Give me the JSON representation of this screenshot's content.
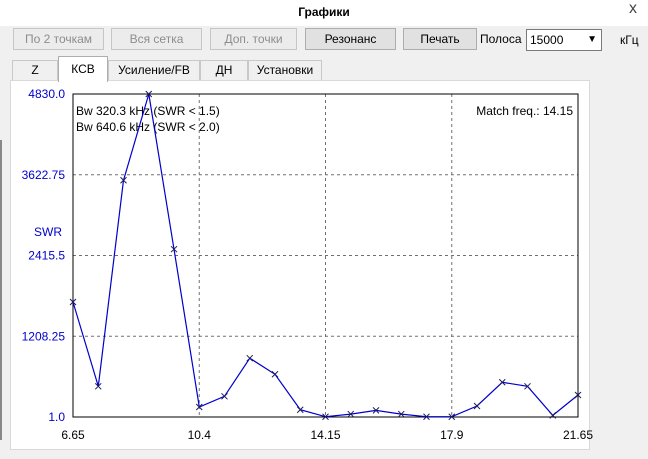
{
  "window": {
    "title": "Графики",
    "close_label": "x"
  },
  "toolbar": {
    "two_points": "По 2 точкам",
    "full_grid": "Вся сетка",
    "extra_points": "Доп. точки",
    "resonance": "Резонанс",
    "print": "Печать",
    "band_label": "Полоса",
    "band_value": "15000",
    "unit": "кГц"
  },
  "tabs": [
    {
      "label": "Z"
    },
    {
      "label": "КСВ",
      "active": true
    },
    {
      "label": "Усиление/FB"
    },
    {
      "label": "ДН"
    },
    {
      "label": "Установки"
    }
  ],
  "chart_data": {
    "type": "line",
    "ylabel": "SWR",
    "y_ticks": [
      "4830.0",
      "3622.75",
      "2415.5",
      "1208.25",
      "1.0"
    ],
    "x_ticks": [
      "6.65",
      "10.4",
      "14.15",
      "17.9",
      "21.65"
    ],
    "xlim": [
      6.65,
      21.65
    ],
    "ylim": [
      1.0,
      4830.0
    ],
    "grid": true,
    "annotations": {
      "bw1": "Bw 320.3 kHz (SWR < 1.5)",
      "bw2": "Bw 640.6 kHz (SWR < 2.0)",
      "match": "Match freq.: 14.15"
    },
    "color": "#0000cc",
    "marker": "x",
    "x": [
      6.65,
      7.4,
      8.15,
      8.9,
      9.65,
      10.4,
      11.15,
      11.9,
      12.65,
      13.4,
      14.15,
      14.9,
      15.65,
      16.4,
      17.15,
      17.9,
      18.65,
      19.4,
      20.15,
      20.9,
      21.65
    ],
    "y": [
      1720,
      460,
      3540,
      4830,
      2510,
      150,
      310,
      880,
      640,
      110,
      5,
      45,
      100,
      45,
      5,
      5,
      165,
      520,
      460,
      25,
      330
    ]
  }
}
